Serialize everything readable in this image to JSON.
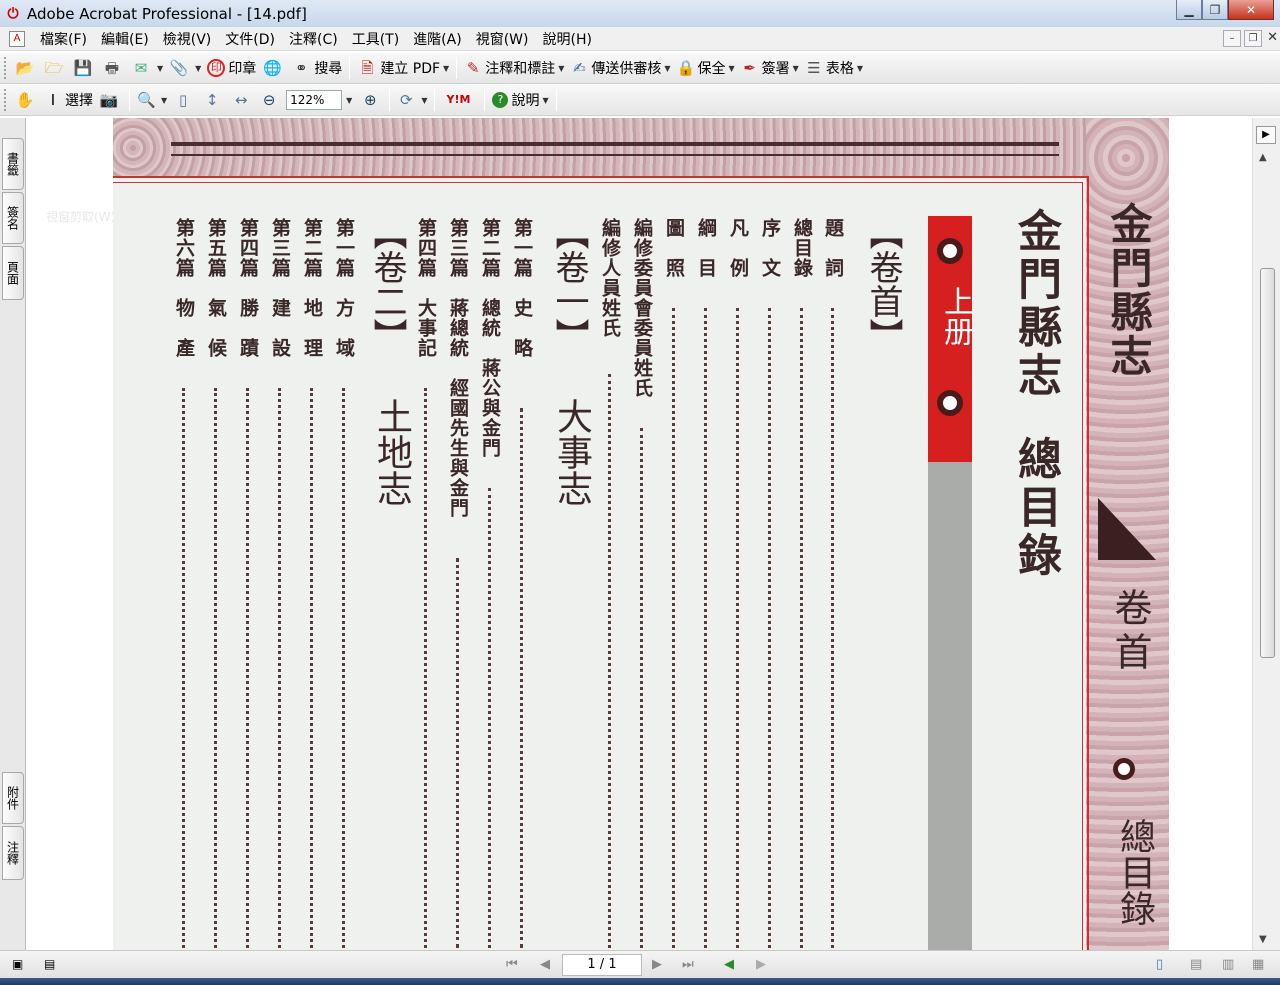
{
  "window": {
    "title": "Adobe Acrobat Professional - [14.pdf]"
  },
  "menu": [
    "檔案(F)",
    "編輯(E)",
    "檢視(V)",
    "文件(D)",
    "注釋(C)",
    "工具(T)",
    "進階(A)",
    "視窗(W)",
    "說明(H)"
  ],
  "toolbar1": {
    "stamp": "印章",
    "search": "搜尋",
    "create_pdf": "建立 PDF",
    "comment": "注釋和標註",
    "review": "傳送供審核",
    "secure": "保全",
    "sign": "簽署",
    "forms": "表格"
  },
  "toolbar2": {
    "select": "選擇",
    "zoom": "122%",
    "help": "說明"
  },
  "side_tabs": {
    "bookmarks": "書籤",
    "signatures": "簽名",
    "pages": "頁面",
    "attachments": "附件",
    "comments": "注釋"
  },
  "tooltip_ghost": "視窗剪取(W)",
  "pdf": {
    "main_title": "金門縣志",
    "main_subtitle": "總目錄",
    "band_label": "上册",
    "side_title": "金門縣志",
    "side_sub": "卷首",
    "side_sub2": "總目錄",
    "toc": [
      "【卷首】",
      "題　詞",
      "總目錄",
      "序　文",
      "凡　例",
      "綱　目",
      "圖　照",
      "編修委員會委員姓氏",
      "編修人員姓氏",
      "【卷一】",
      "大事志",
      "第一篇　史　略",
      "第二篇　總統　蔣公與金門",
      "第三篇　蔣總統　經國先生與金門",
      "第四篇　大事記",
      "【卷二】",
      "土地志",
      "第一篇　方　域",
      "第二篇　地　理",
      "第三篇　建　設",
      "第四篇　勝　蹟",
      "第五篇　氣　候",
      "第六篇　物　產"
    ]
  },
  "status": {
    "page_indicator": "1 / 1"
  }
}
